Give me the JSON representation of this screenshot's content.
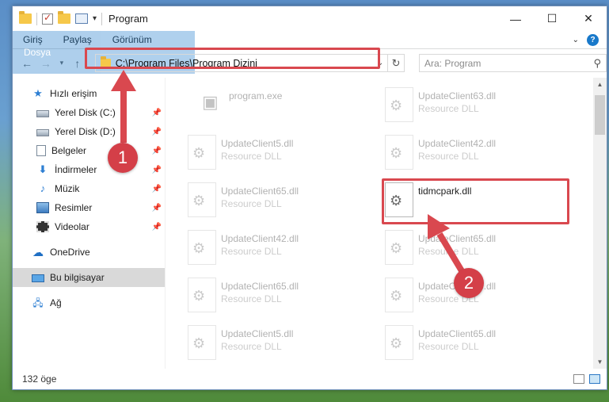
{
  "window": {
    "title": "Program",
    "controls": {
      "minimize": "—",
      "maximize": "☐",
      "close": "✕"
    }
  },
  "ribbon": {
    "tabs": [
      "Dosya",
      "Giriş",
      "Paylaş",
      "Görünüm"
    ],
    "help": "?"
  },
  "address": {
    "path": "C:\\Program Files\\Program Dizini",
    "search_placeholder": "Ara: Program"
  },
  "sidebar": {
    "quick_access": "Hızlı erişim",
    "items": [
      {
        "label": "Yerel Disk (C:)",
        "icon": "drive-icon"
      },
      {
        "label": "Yerel Disk (D:)",
        "icon": "drive-icon"
      },
      {
        "label": "Belgeler",
        "icon": "documents-icon"
      },
      {
        "label": "İndirmeler",
        "icon": "downloads-icon"
      },
      {
        "label": "Müzik",
        "icon": "music-icon"
      },
      {
        "label": "Resimler",
        "icon": "pictures-icon"
      },
      {
        "label": "Videolar",
        "icon": "videos-icon"
      }
    ],
    "onedrive": "OneDrive",
    "this_pc": "Bu bilgisayar",
    "network": "Ağ"
  },
  "files": [
    {
      "name": "program.exe",
      "type": ""
    },
    {
      "name": "UpdateClient63.dll",
      "type": "Resource DLL"
    },
    {
      "name": "UpdateClient5.dll",
      "type": "Resource DLL"
    },
    {
      "name": "UpdateClient42.dll",
      "type": "Resource DLL"
    },
    {
      "name": "UpdateClient65.dll",
      "type": "Resource DLL"
    },
    {
      "name": "tidmcpark.dll",
      "type": ""
    },
    {
      "name": "UpdateClient42.dll",
      "type": "Resource DLL"
    },
    {
      "name": "UpdateClient65.dll",
      "type": "Resource DLL"
    },
    {
      "name": "UpdateClient65.dll",
      "type": "Resource DLL"
    },
    {
      "name": "UpdateClient65.dll",
      "type": "Resource DLL"
    },
    {
      "name": "UpdateClient5.dll",
      "type": "Resource DLL"
    },
    {
      "name": "UpdateClient65.dll",
      "type": "Resource DLL"
    }
  ],
  "status": {
    "count": "132 öge"
  },
  "annotations": {
    "step1": "1",
    "step2": "2",
    "color": "#d9484f"
  }
}
